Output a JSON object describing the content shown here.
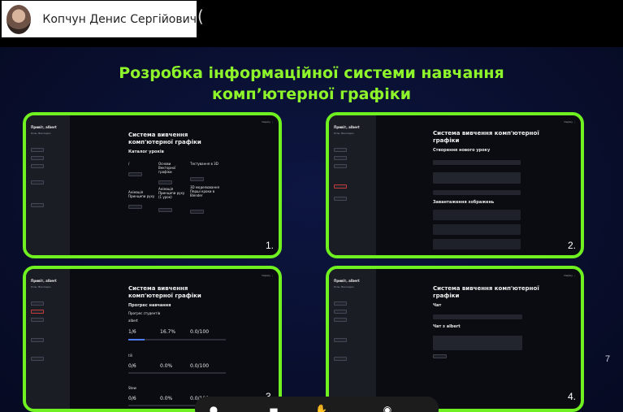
{
  "participant": {
    "name": "Копчун Денис Сергійович",
    "paren": "("
  },
  "slide": {
    "title_line1": "Розробка інформаційної системи навчання",
    "title_line2": "комп’ютерної графіки",
    "page_number": "7",
    "accent_color": "#6ff020"
  },
  "screens": [
    {
      "number": "1.",
      "app_title": "Система вивчення комп'ютерної графіки",
      "section": "Каталог уроків",
      "lessons": [
        {
          "title": "/"
        },
        {
          "title": "Основи Векторної графіки"
        },
        {
          "title": "Тестування в 3D"
        },
        {
          "title": "Анімація Принципи руху"
        },
        {
          "title": "Анімація Принципи руху (1 урок)"
        },
        {
          "title": "3D моделювання Перші кроки в Blender"
        }
      ]
    },
    {
      "number": "2.",
      "app_title": "Система вивчення комп'ютерної графіки",
      "section": "Створення нового уроку",
      "upload_section": "Завантаження зображень"
    },
    {
      "number": "3.",
      "app_title": "Система вивчення комп'ютерної графіки",
      "section": "Прогрес навчання",
      "subsection": "Прогрес студентів",
      "students": [
        {
          "name": "albert",
          "stat1": "1/6",
          "stat2": "16.7%",
          "stat3": "0.0/100",
          "progress": 0.167
        },
        {
          "name": "tili",
          "stat1": "0/6",
          "stat2": "0.0%",
          "stat3": "0.0/100",
          "progress": 0
        },
        {
          "name": "Stew",
          "stat1": "0/6",
          "stat2": "0.0%",
          "stat3": "0.0/100",
          "progress": 0
        }
      ]
    },
    {
      "number": "4.",
      "app_title": "Система вивчення комп'ютерної графіки",
      "section": "Чат",
      "subsection": "Чат з albert"
    }
  ],
  "toolbar": {
    "icons": [
      "mic-icon",
      "camera-icon",
      "hand-icon",
      "hangup-icon"
    ]
  }
}
